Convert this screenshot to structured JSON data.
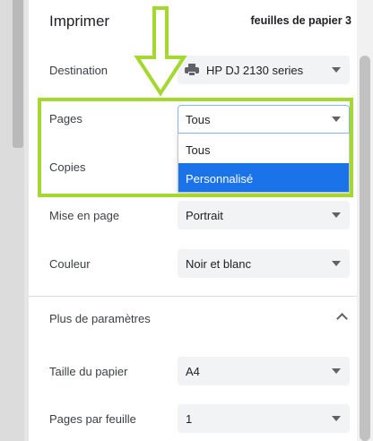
{
  "header": {
    "title": "Imprimer",
    "sheet_count": "feuilles de papier 3"
  },
  "destination": {
    "label": "Destination",
    "value": "HP DJ 2130 series",
    "icon": "printer-icon"
  },
  "pages": {
    "label": "Pages",
    "value": "Tous",
    "options": [
      "Tous",
      "Personnalisé"
    ],
    "highlighted_option": "Personnalisé"
  },
  "copies": {
    "label": "Copies"
  },
  "layout": {
    "label": "Mise en page",
    "value": "Portrait"
  },
  "color": {
    "label": "Couleur",
    "value": "Noir et blanc"
  },
  "more_settings": {
    "label": "Plus de paramètres",
    "icon": "chevron-up-icon"
  },
  "paper_size": {
    "label": "Taille du papier",
    "value": "A4"
  },
  "pages_per_sheet": {
    "label": "Pages par feuille",
    "value": "1"
  },
  "colors": {
    "accent": "#1a73e8",
    "annotation": "#a4d82f",
    "field_bg": "#f1f3f4"
  }
}
